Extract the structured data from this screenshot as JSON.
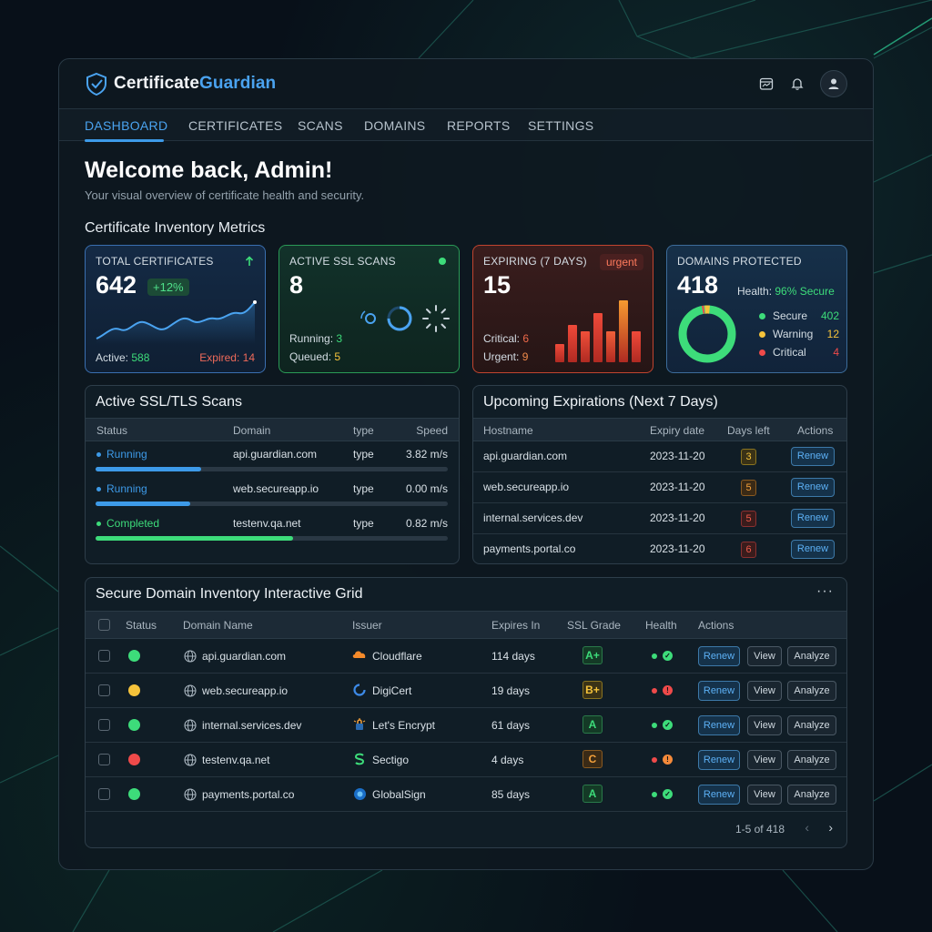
{
  "brand": {
    "name_part1": "Certificate",
    "name_part2": "Guardian"
  },
  "nav": [
    "DASHBOARD",
    "CERTIFICATES",
    "SCANS",
    "DOMAINS",
    "REPORTS",
    "SETTINGS"
  ],
  "welcome": {
    "title": "Welcome back, Admin!",
    "subtitle": "Your visual overview of certificate health and security."
  },
  "metrics": {
    "section_title": "Certificate Inventory Metrics",
    "total": {
      "label": "TOTAL CERTIFICATES",
      "value": "642",
      "change": "+12%",
      "active_label": "Active:",
      "active": "588",
      "expired_label": "Expired:",
      "expired": "14"
    },
    "scans": {
      "label": "ACTIVE SSL SCANS",
      "value": "8",
      "running_label": "Running:",
      "running": "3",
      "queued_label": "Queued:",
      "queued": "5"
    },
    "expiring": {
      "label": "EXPIRING (7 DAYS)",
      "badge": "urgent",
      "value": "15",
      "critical_label": "Critical:",
      "critical": "6",
      "urgent_label": "Urgent:",
      "urgent": "9",
      "bars": [
        0.3,
        0.6,
        0.5,
        0.8,
        0.5,
        1.0,
        0.5
      ]
    },
    "domains": {
      "label": "DOMAINS PROTECTED",
      "value": "418",
      "health_label": "Health:",
      "health": "96% Secure",
      "legend": [
        {
          "name": "Secure",
          "value": "402",
          "color": "#3ddc7a"
        },
        {
          "name": "Warning",
          "value": "12",
          "color": "#f5c33b"
        },
        {
          "name": "Critical",
          "value": "4",
          "color": "#ef4a4a"
        }
      ]
    }
  },
  "scans_panel": {
    "title": "Active SSL/TLS Scans",
    "headers": [
      "Status",
      "Domain",
      "type",
      "Speed"
    ],
    "rows": [
      {
        "status": "Running",
        "domain": "api.guardian.com",
        "type": "type",
        "speed": "3.82 m/s",
        "progress": 0.3,
        "color": "#3d9ae8"
      },
      {
        "status": "Running",
        "domain": "web.secureapp.io",
        "type": "type",
        "speed": "0.00 m/s",
        "progress": 0.27,
        "color": "#3d9ae8"
      },
      {
        "status": "Completed",
        "domain": "testenv.qa.net",
        "type": "type",
        "speed": "0.82 m/s",
        "progress": 0.56,
        "color": "#3ddc7a"
      }
    ]
  },
  "expirations": {
    "title": "Upcoming Expirations (Next 7 Days)",
    "headers": [
      "Hostname",
      "Expiry date",
      "Days left",
      "Actions"
    ],
    "rows": [
      {
        "host": "api.guardian.com",
        "date": "2023-11-20",
        "days": "3",
        "action": "Renew"
      },
      {
        "host": "web.secureapp.io",
        "date": "2023-11-20",
        "days": "5",
        "action": "Renew"
      },
      {
        "host": "internal.services.dev",
        "date": "2023-11-20",
        "days": "5",
        "action": "Renew"
      },
      {
        "host": "payments.portal.co",
        "date": "2023-11-20",
        "days": "6",
        "action": "Renew"
      }
    ]
  },
  "grid": {
    "title": "Secure Domain Inventory Interactive Grid",
    "headers": [
      "Status",
      "Domain Name",
      "Issuer",
      "Expires In",
      "SSL Grade",
      "Health",
      "Actions"
    ],
    "buttons": {
      "renew": "Renew",
      "view": "View",
      "analyze": "Analyze"
    },
    "rows": [
      {
        "domain": "api.guardian.com",
        "issuer": "Cloudflare",
        "expires": "114 days",
        "grade": "A+",
        "status": "#3ddc7a"
      },
      {
        "domain": "web.secureapp.io",
        "issuer": "DigiCert",
        "expires": "19 days",
        "grade": "B+",
        "status": "#f5c33b"
      },
      {
        "domain": "internal.services.dev",
        "issuer": "Let's Encrypt",
        "expires": "61 days",
        "grade": "A",
        "status": "#3ddc7a"
      },
      {
        "domain": "testenv.qa.net",
        "issuer": "Sectigo",
        "expires": "4 days",
        "grade": "C",
        "status": "#ef4a4a"
      },
      {
        "domain": "payments.portal.co",
        "issuer": "GlobalSign",
        "expires": "85 days",
        "grade": "A",
        "status": "#3ddc7a"
      }
    ],
    "pagination": "1-5 of 418"
  }
}
